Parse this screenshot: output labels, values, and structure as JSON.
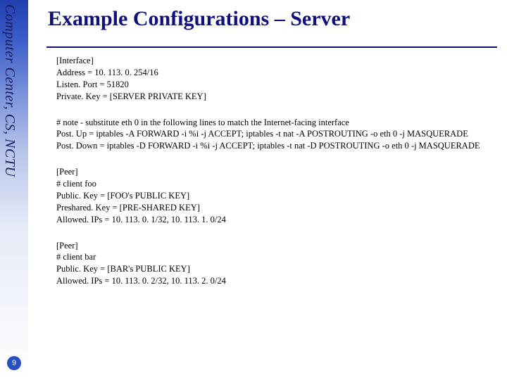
{
  "sidebar_label": "Computer Center, CS, NCTU",
  "page_number": "9",
  "title": "Example Configurations – Server",
  "blocks": [
    {
      "lines": [
        "[Interface]",
        "Address = 10. 113. 0. 254/16",
        "Listen. Port = 51820",
        "Private. Key = [SERVER PRIVATE KEY]"
      ]
    },
    {
      "lines": [
        "# note - substitute eth 0 in the following lines to match the Internet-facing interface",
        "Post. Up = iptables -A FORWARD -i %i -j ACCEPT; iptables -t nat -A POSTROUTING -o eth 0 -j MASQUERADE",
        "Post. Down = iptables -D FORWARD -i %i -j ACCEPT; iptables -t nat -D POSTROUTING -o eth 0 -j MASQUERADE"
      ]
    },
    {
      "lines": [
        "[Peer]",
        "# client foo",
        "Public. Key = [FOO's PUBLIC KEY]",
        "Preshared. Key = [PRE-SHARED KEY]",
        "Allowed. IPs = 10. 113. 0. 1/32, 10. 113. 1. 0/24"
      ]
    },
    {
      "lines": [
        "[Peer]",
        "# client bar",
        "Public. Key = [BAR's PUBLIC KEY]",
        "Allowed. IPs = 10. 113. 0. 2/32, 10. 113. 2. 0/24"
      ]
    }
  ]
}
